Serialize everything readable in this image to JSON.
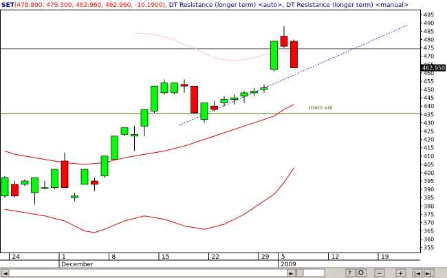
{
  "header": {
    "symbol": "SET",
    "ohlc": "(478.800, 479.300, 462.960, 462.960, -10.1900)",
    "studies": ", DT Resistance (longer term) <auto>, DT Resistance (longer term) <manual>"
  },
  "toolbar": {
    "help_icon": "help-icon",
    "zoom_icon": "zoom-icon"
  },
  "chart_data": {
    "type": "candlestick",
    "ylim": [
      352,
      498
    ],
    "y_ticks": [
      355,
      360,
      365,
      370,
      375,
      380,
      385,
      390,
      395,
      400,
      405,
      410,
      415,
      420,
      425,
      430,
      435,
      440,
      445,
      450,
      455,
      460,
      465,
      470,
      475,
      480,
      485,
      490,
      495
    ],
    "last_price_label": "462.950",
    "x_day_labels": [
      {
        "text": "24",
        "index": 1
      },
      {
        "text": "1",
        "index": 6
      },
      {
        "text": "8",
        "index": 11
      },
      {
        "text": "15",
        "index": 16
      },
      {
        "text": "22",
        "index": 21
      },
      {
        "text": "29",
        "index": 26
      },
      {
        "text": "5",
        "index": 28
      },
      {
        "text": "12",
        "index": 33
      },
      {
        "text": "19",
        "index": 38
      }
    ],
    "month_labels": [
      {
        "text": "December",
        "index": 6
      },
      {
        "text": "2009",
        "index": 28
      }
    ],
    "candles": [
      {
        "o": 386,
        "h": 398,
        "l": 385,
        "c": 397
      },
      {
        "o": 393,
        "h": 395,
        "l": 385,
        "c": 386
      },
      {
        "o": 393,
        "h": 396,
        "l": 392,
        "c": 395
      },
      {
        "o": 388,
        "h": 397,
        "l": 381,
        "c": 397
      },
      {
        "o": 391,
        "h": 395,
        "l": 390,
        "c": 391
      },
      {
        "o": 391,
        "h": 402,
        "l": 390,
        "c": 402
      },
      {
        "o": 407,
        "h": 412,
        "l": 391,
        "c": 391
      },
      {
        "o": 385,
        "h": 388,
        "l": 383,
        "c": 386
      },
      {
        "o": 393,
        "h": 402,
        "l": 393,
        "c": 402
      },
      {
        "o": 395,
        "h": 397,
        "l": 389,
        "c": 393
      },
      {
        "o": 398,
        "h": 410,
        "l": 397,
        "c": 410
      },
      {
        "o": 408,
        "h": 422,
        "l": 408,
        "c": 422
      },
      {
        "o": 423,
        "h": 427,
        "l": 422,
        "c": 427
      },
      {
        "o": 422,
        "h": 428,
        "l": 413,
        "c": 423
      },
      {
        "o": 428,
        "h": 438,
        "l": 422,
        "c": 438
      },
      {
        "o": 437,
        "h": 452,
        "l": 436,
        "c": 452
      },
      {
        "o": 448,
        "h": 456,
        "l": 447,
        "c": 454
      },
      {
        "o": 448,
        "h": 454,
        "l": 447,
        "c": 454
      },
      {
        "o": 453,
        "h": 456,
        "l": 448,
        "c": 452
      },
      {
        "o": 452,
        "h": 452,
        "l": 436,
        "c": 436
      },
      {
        "o": 432,
        "h": 442,
        "l": 430,
        "c": 442
      },
      {
        "o": 440,
        "h": 443,
        "l": 437,
        "c": 438
      },
      {
        "o": 442,
        "h": 446,
        "l": 440,
        "c": 444
      },
      {
        "o": 444,
        "h": 447,
        "l": 441,
        "c": 445
      },
      {
        "o": 446,
        "h": 449,
        "l": 442,
        "c": 448
      },
      {
        "o": 448,
        "h": 451,
        "l": 446,
        "c": 449
      },
      {
        "o": 450,
        "h": 453,
        "l": 448,
        "c": 451
      },
      {
        "o": 462,
        "h": 479,
        "l": 461,
        "c": 479
      },
      {
        "o": 482,
        "h": 488,
        "l": 475,
        "c": 476
      },
      {
        "o": 479,
        "h": 480,
        "l": 463,
        "c": 463
      }
    ],
    "upper_band": [
      [
        13,
        484
      ],
      [
        15,
        483
      ],
      [
        17,
        480
      ],
      [
        18,
        477
      ],
      [
        19,
        475
      ],
      [
        20,
        472
      ],
      [
        21,
        469
      ],
      [
        23,
        467
      ],
      [
        25,
        469
      ],
      [
        26,
        471
      ],
      [
        27,
        472
      ],
      [
        28,
        473
      ],
      [
        29,
        473
      ]
    ],
    "mid_band": [
      [
        0,
        413
      ],
      [
        1,
        411
      ],
      [
        2,
        410
      ],
      [
        4,
        408
      ],
      [
        6,
        406
      ],
      [
        8,
        405
      ],
      [
        10,
        406
      ],
      [
        12,
        409
      ],
      [
        14,
        411
      ],
      [
        16,
        413
      ],
      [
        18,
        416
      ],
      [
        20,
        420
      ],
      [
        22,
        424
      ],
      [
        24,
        428
      ],
      [
        26,
        432
      ],
      [
        27,
        434
      ],
      [
        28,
        438
      ],
      [
        29,
        441
      ]
    ],
    "lower_band": [
      [
        0,
        378
      ],
      [
        2,
        376
      ],
      [
        4,
        374
      ],
      [
        6,
        371
      ],
      [
        7,
        368
      ],
      [
        8,
        365
      ],
      [
        9,
        364
      ],
      [
        10,
        366
      ],
      [
        12,
        371
      ],
      [
        14,
        374
      ],
      [
        16,
        372
      ],
      [
        18,
        368
      ],
      [
        20,
        366
      ],
      [
        22,
        369
      ],
      [
        24,
        375
      ],
      [
        26,
        383
      ],
      [
        27,
        387
      ],
      [
        28,
        394
      ],
      [
        29,
        403
      ]
    ],
    "horizontal_lines": [
      {
        "value": 474.5,
        "color": "#555555"
      },
      {
        "value": 435.5,
        "color": "#4a6a00"
      }
    ],
    "trend_line": {
      "from": [
        17.5,
        428.5
      ],
      "to": [
        40.5,
        489
      ],
      "color": "#3333cc"
    },
    "annotation": {
      "text": "main vol",
      "value": 438,
      "index": 30.5
    }
  }
}
